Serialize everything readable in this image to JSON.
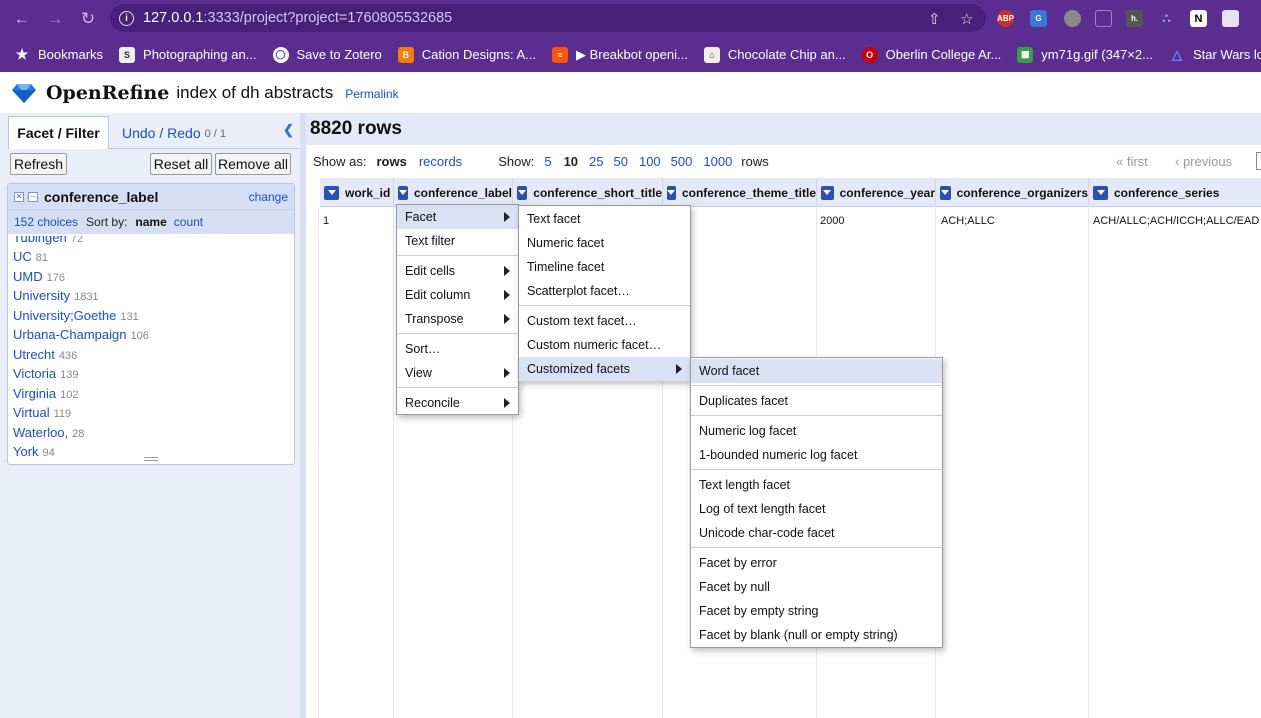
{
  "browser": {
    "url_host": "127.0.0.1",
    "url_path": ":3333/project?project=1760805532685",
    "bookmarks": [
      {
        "label": "Bookmarks",
        "icon": "star-icon"
      },
      {
        "label": "Photographing an...",
        "icon": "s-favicon"
      },
      {
        "label": "Save to Zotero",
        "icon": "globe-icon"
      },
      {
        "label": "Cation Designs: A...",
        "icon": "blogger-favicon"
      },
      {
        "label": "▶ Breakbot openi...",
        "icon": "soundcloud-favicon"
      },
      {
        "label": "Chocolate Chip an...",
        "icon": "house-favicon"
      },
      {
        "label": "Oberlin College Ar...",
        "icon": "oberlin-favicon"
      },
      {
        "label": "ym71g.gif (347×2...",
        "icon": "image-favicon"
      },
      {
        "label": "Star Wars locati",
        "icon": "triangle-favicon"
      }
    ],
    "extensions": [
      "ABP"
    ]
  },
  "app": {
    "name": "OpenRefine",
    "project": "index of dh abstracts",
    "permalink": "Permalink"
  },
  "left_panel": {
    "tab_facet": "Facet / Filter",
    "tab_undo": "Undo / Redo",
    "undo_count": "0 / 1",
    "refresh": "Refresh",
    "reset_all": "Reset all",
    "remove_all": "Remove all",
    "facet": {
      "title": "conference_label",
      "change": "change",
      "choices": "152 choices",
      "sort_by": "Sort by:",
      "sort_name": "name",
      "sort_count": "count",
      "items": [
        {
          "name": "Tubingen",
          "count": "72"
        },
        {
          "name": "UC",
          "count": "81"
        },
        {
          "name": "UMD",
          "count": "176"
        },
        {
          "name": "University",
          "count": "1831"
        },
        {
          "name": "University;Goethe",
          "count": "131"
        },
        {
          "name": "Urbana-Champaign",
          "count": "106"
        },
        {
          "name": "Utrecht",
          "count": "436"
        },
        {
          "name": "Victoria",
          "count": "139"
        },
        {
          "name": "Virginia",
          "count": "102"
        },
        {
          "name": "Virtual",
          "count": "119"
        },
        {
          "name": "Waterloo,",
          "count": "28"
        },
        {
          "name": "York",
          "count": "94"
        }
      ]
    }
  },
  "main": {
    "row_count": "8820 rows",
    "show_as": "Show as:",
    "rows": "rows",
    "records": "records",
    "show": "Show:",
    "page_sizes": [
      "5",
      "10",
      "25",
      "50",
      "100",
      "500",
      "1000"
    ],
    "rows_suffix": "rows",
    "first": "« first",
    "previous": "‹ previous",
    "columns": [
      "work_id",
      "conference_label",
      "conference_short_title",
      "conference_theme_title",
      "conference_year",
      "conference_organizers",
      "conference_series"
    ],
    "row": {
      "index": "1",
      "year": "2000",
      "organizers": "ACH;ALLC",
      "series": "ACH/ALLC;ACH/ICCH;ALLC/EAD"
    }
  },
  "menus": {
    "column_menu": [
      "Facet",
      "Text filter",
      "Edit cells",
      "Edit column",
      "Transpose",
      "Sort…",
      "View",
      "Reconcile"
    ],
    "facet_menu": [
      "Text facet",
      "Numeric facet",
      "Timeline facet",
      "Scatterplot facet…",
      "Custom text facet…",
      "Custom numeric facet…",
      "Customized facets"
    ],
    "customized_menu": [
      "Word facet",
      "Duplicates facet",
      "Numeric log facet",
      "1-bounded numeric log facet",
      "Text length facet",
      "Log of text length facet",
      "Unicode char-code facet",
      "Facet by error",
      "Facet by null",
      "Facet by empty string",
      "Facet by blank (null or empty string)"
    ]
  }
}
